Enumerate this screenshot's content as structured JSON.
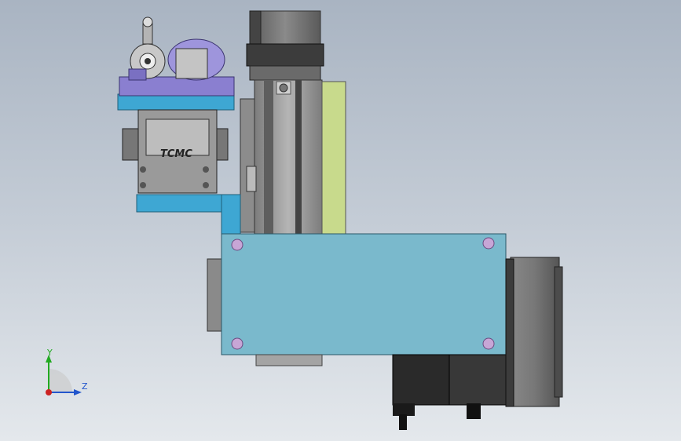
{
  "colors": {
    "background_top": "#a9b4c2",
    "background_bottom": "#e4e8ec",
    "mount_plate": "#7ab9cc",
    "bracket": "#3ea7d3",
    "clamp_body": "#8a7fd0",
    "rail": "#c8da8c",
    "motor": "#6d6d6d",
    "gearbox": "#2a2a2a",
    "bolt": "#c7a6d6"
  },
  "model": {
    "brand_label": "TCMC"
  },
  "triad": {
    "y_label": "Y",
    "z_label": "Z",
    "y_color": "#22aa22",
    "z_color": "#2255cc",
    "x_color": "#cc2222"
  }
}
